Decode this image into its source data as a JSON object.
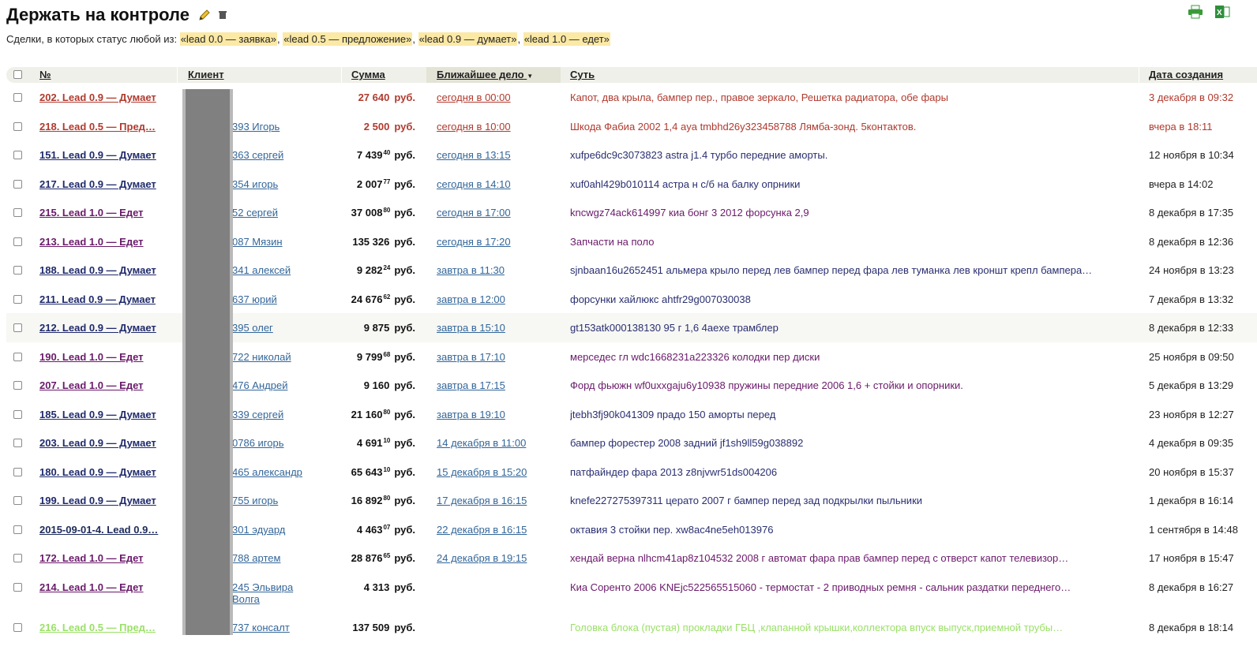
{
  "header": {
    "title": "Держать на контроле",
    "pencil_icon": "pencil-icon",
    "trash_icon": "trash-icon",
    "print_icon": "printer-icon",
    "excel_icon": "excel-icon"
  },
  "filter": {
    "prefix": "Сделки, в которых статус любой из: ",
    "tags": [
      "«lead 0.0 — заявка»",
      "«lead 0.5 — предложение»",
      "«lead 0.9 — думает»",
      "«lead 1.0 — едет»"
    ],
    "sep": ", "
  },
  "columns": {
    "num": "№",
    "client": "Клиент",
    "sum": "Сумма",
    "deal": "Ближайшее дело",
    "essence": "Суть",
    "date": "Дата создания"
  },
  "rows": [
    {
      "num": "202. Lead 0.9 — Думает",
      "client": "",
      "sum": "27 640",
      "cents": "",
      "cur": "руб.",
      "deal": "сегодня в 00:00",
      "essence": "Капот, два крыла, бампер пер., правое зеркало, Решетка радиатора, обе фары",
      "date": "3 декабря в 09:32",
      "style": "st-red"
    },
    {
      "num": "218. Lead 0.5 — Пред…",
      "client": "393 Игорь",
      "sum": "2 500",
      "cents": "",
      "cur": "руб.",
      "deal": "сегодня в 10:00",
      "essence": "Шкода Фабиа 2002 1,4 aya tmbhd26y323458788 Лямба-зонд. 5контактов.",
      "date": "вчера в 18:11",
      "style": "st-red"
    },
    {
      "num": "151. Lead 0.9 — Думает",
      "client": "363 сергей",
      "sum": "7 439",
      "cents": "40",
      "cur": "руб.",
      "deal": "сегодня в 13:15",
      "essence": "xufpe6dc9c3073823 astra j1.4 турбо передние аморты.",
      "date": "12 ноября в 10:34",
      "style": "st-navy"
    },
    {
      "num": "217. Lead 0.9 — Думает",
      "client": "354 игорь",
      "sum": "2 007",
      "cents": "77",
      "cur": "руб.",
      "deal": "сегодня в 14:10",
      "essence": "xuf0ahl429b010114 астра н с/б на балку опрники",
      "date": "вчера в 14:02",
      "style": "st-navy"
    },
    {
      "num": "215. Lead 1.0 — Едет",
      "client": "52 сергей",
      "sum": "37 008",
      "cents": "80",
      "cur": "руб.",
      "deal": "сегодня в 17:00",
      "essence": "kncwgz74ack614997 киа бонг 3 2012 форсунка 2,9",
      "date": "8 декабря в 17:35",
      "style": "st-purple"
    },
    {
      "num": "213. Lead 1.0 — Едет",
      "client": "087 Мязин",
      "sum": "135 326",
      "cents": "",
      "cur": "руб.",
      "deal": "сегодня в 17:20",
      "essence": "Запчасти на поло",
      "date": "8 декабря в 12:36",
      "style": "st-purple"
    },
    {
      "num": "188. Lead 0.9 — Думает",
      "client": "341 алексей",
      "sum": "9 282",
      "cents": "24",
      "cur": "руб.",
      "deal": "завтра в 11:30",
      "essence": "sjnbaan16u2652451 альмера крыло перед лев бампер перед фара лев туманка лев кроншт крепл бампера…",
      "date": "24 ноября в 13:23",
      "style": "st-navy"
    },
    {
      "num": "211. Lead 0.9 — Думает",
      "client": "637 юрий",
      "sum": "24 676",
      "cents": "62",
      "cur": "руб.",
      "deal": "завтра в 12:00",
      "essence": "форсунки хайлюкс ahtfr29g007030038",
      "date": "7 декабря в 13:32",
      "style": "st-navy"
    },
    {
      "num": "212. Lead 0.9 — Думает",
      "client": "395 олег",
      "sum": "9 875",
      "cents": "",
      "cur": "руб.",
      "deal": "завтра в 15:10",
      "essence": "gt153atk000138130 95 г 1,6 4aexe трамблер",
      "date": "8 декабря в 12:33",
      "style": "st-navy"
    },
    {
      "num": "190. Lead 1.0 — Едет",
      "client": "722 николай",
      "sum": "9 799",
      "cents": "68",
      "cur": "руб.",
      "deal": "завтра в 17:10",
      "essence": "мерседес гл wdc1668231a223326 колодки пер диски",
      "date": "25 ноября в 09:50",
      "style": "st-purple"
    },
    {
      "num": "207. Lead 1.0 — Едет",
      "client": "476 Андрей",
      "sum": "9 160",
      "cents": "",
      "cur": "руб.",
      "deal": "завтра в 17:15",
      "essence": "Форд фьюжн wf0uxxgaju6y10938 пружины передние 2006 1,6 + стойки и опорники.",
      "date": "5 декабря в 13:29",
      "style": "st-purple"
    },
    {
      "num": "185. Lead 0.9 — Думает",
      "client": "339 сергей",
      "sum": "21 160",
      "cents": "80",
      "cur": "руб.",
      "deal": "завтра в 19:10",
      "essence": "jtebh3fj90k041309 прадо 150 аморты перед",
      "date": "23 ноября в 12:27",
      "style": "st-navy"
    },
    {
      "num": "203. Lead 0.9 — Думает",
      "client": "0786 игорь",
      "sum": "4 691",
      "cents": "10",
      "cur": "руб.",
      "deal": "14 декабря в 11:00",
      "essence": "бампер форестер 2008 задний jf1sh9ll59g038892",
      "date": "4 декабря в 09:35",
      "style": "st-navy"
    },
    {
      "num": "180. Lead 0.9 — Думает",
      "client": "465 александр",
      "sum": "65 643",
      "cents": "10",
      "cur": "руб.",
      "deal": "15 декабря в 15:20",
      "essence": "патфайндер фара 2013 z8njvwr51ds004206",
      "date": "20 ноября в 15:37",
      "style": "st-navy"
    },
    {
      "num": "199. Lead 0.9 — Думает",
      "client": "755 игорь",
      "sum": "16 892",
      "cents": "80",
      "cur": "руб.",
      "deal": "17 декабря в 16:15",
      "essence": "knefe227275397311 церато 2007 г бампер перед зад подкрылки пыльники",
      "date": "1 декабря в 16:14",
      "style": "st-navy"
    },
    {
      "num": "2015-09-01-4. Lead 0.9…",
      "client": "301 эдуард",
      "sum": "4 463",
      "cents": "07",
      "cur": "руб.",
      "deal": "22 декабря в 16:15",
      "essence": "октавия 3 стойки пер. xw8ac4ne5eh013976",
      "date": "1 сентября в 14:48",
      "style": "st-navy-dark"
    },
    {
      "num": "172. Lead 1.0 — Едет",
      "client": "788 артем",
      "sum": "28 876",
      "cents": "65",
      "cur": "руб.",
      "deal": "24 декабря в 19:15",
      "essence": "хендай верна nlhcm41ap8z104532 2008 г автомат фара прав бампер перед с отверст капот телевизор…",
      "date": "17 ноября в 15:47",
      "style": "st-purple"
    },
    {
      "num": "214. Lead 1.0 — Едет",
      "client": "245 Эльвира Волга",
      "sum": "4 313",
      "cents": "",
      "cur": "руб.",
      "deal": "",
      "essence": "Киа Соренто 2006 KNEjc522565515060 - термостат - 2 приводных ремня - сальник раздатки переднего…",
      "date": "8 декабря в 16:27",
      "style": "st-purple"
    },
    {
      "num": "216. Lead 0.5 — Пред…",
      "client": "737 консалт",
      "sum": "137 509",
      "cents": "",
      "cur": "руб.",
      "deal": "",
      "essence": "Головка блока (пустая) прокладки ГБЦ ,клапанной крышки,коллектора впуск выпуск,приемной трубы…",
      "date": "8 декабря в 18:14",
      "style": "st-green"
    }
  ]
}
